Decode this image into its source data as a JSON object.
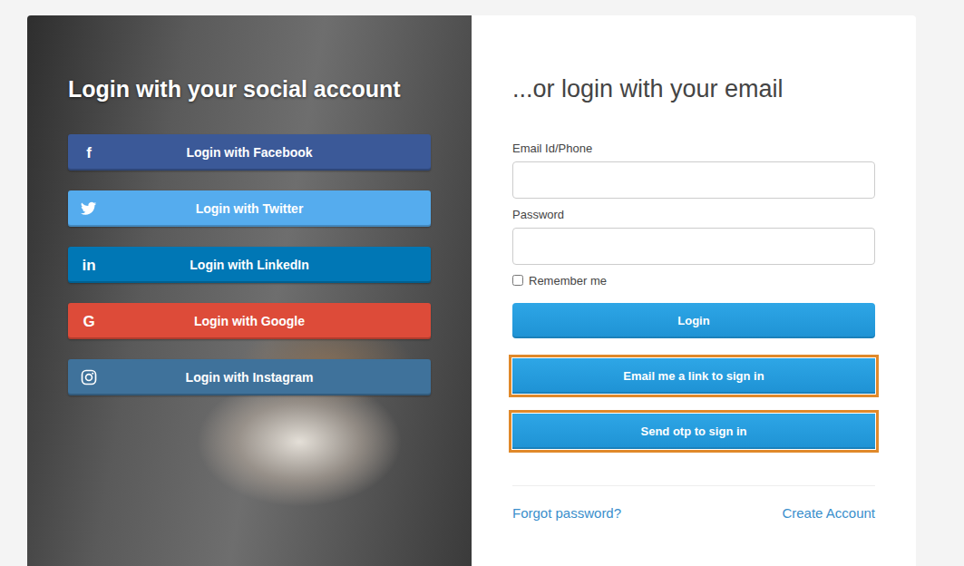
{
  "social": {
    "title": "Login with your social account",
    "buttons": [
      {
        "label": "Login with Facebook",
        "kind": "glyph",
        "glyph": "f",
        "color": "#3b5998"
      },
      {
        "label": "Login with Twitter",
        "kind": "bird",
        "glyph": "",
        "color": "#55acee"
      },
      {
        "label": "Login with LinkedIn",
        "kind": "glyph",
        "glyph": "in",
        "color": "#0077b5"
      },
      {
        "label": "Login with Google",
        "kind": "glyph",
        "glyph": "G",
        "color": "#dd4b39"
      },
      {
        "label": "Login with Instagram",
        "kind": "camera",
        "glyph": "",
        "color": "#3f729b"
      }
    ]
  },
  "email_form": {
    "title": "...or login with your email",
    "fields": [
      {
        "label": "Email Id/Phone",
        "value": "",
        "type": "text"
      },
      {
        "label": "Password",
        "value": "",
        "type": "password"
      }
    ],
    "remember": {
      "label": "Remember me",
      "checked": false
    },
    "buttons": [
      {
        "label": "Login",
        "highlighted": false
      },
      {
        "label": "Email me a link to sign in",
        "highlighted": true
      },
      {
        "label": "Send otp to sign in",
        "highlighted": true
      }
    ],
    "links": [
      {
        "label": "Forgot password?"
      },
      {
        "label": "Create Account"
      }
    ]
  }
}
